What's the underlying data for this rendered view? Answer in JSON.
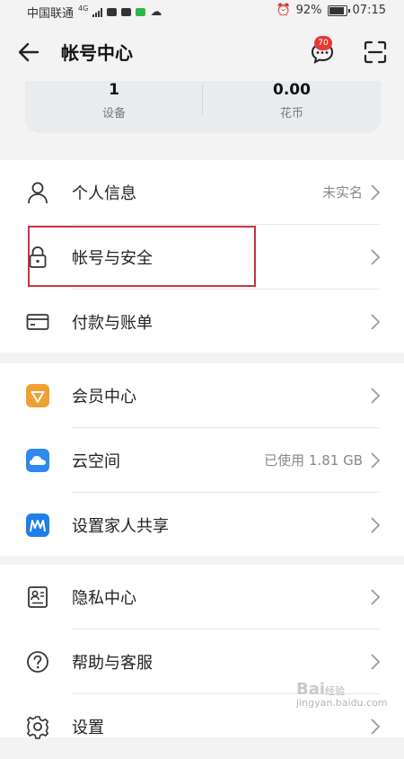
{
  "status_bar": {
    "carrier": "中国联通",
    "network": "4G",
    "battery": "92%",
    "time": "07:15"
  },
  "header": {
    "title": "帐号中心",
    "message_badge": "70"
  },
  "stats": [
    {
      "value": "1",
      "label": "设备"
    },
    {
      "value": "0.00",
      "label": "花币"
    }
  ],
  "section1": [
    {
      "label": "个人信息",
      "value": "未实名"
    },
    {
      "label": "帐号与安全",
      "value": ""
    },
    {
      "label": "付款与账单",
      "value": ""
    }
  ],
  "section2": [
    {
      "label": "会员中心",
      "value": ""
    },
    {
      "label": "云空间",
      "value": "已使用 1.81 GB"
    },
    {
      "label": "设置家人共享",
      "value": ""
    }
  ],
  "section3": [
    {
      "label": "隐私中心",
      "value": ""
    },
    {
      "label": "帮助与客服",
      "value": ""
    },
    {
      "label": "设置",
      "value": ""
    }
  ],
  "colors": {
    "highlight_box": "#c8343f",
    "member_icon": "#f0a030",
    "cloud_icon": "#2e88ee",
    "family_icon": "#1f7fe8",
    "badge": "#e53935"
  },
  "watermark": {
    "brand": "Bai",
    "brand_paw": "经验",
    "url": "jingyan.baidu.com"
  }
}
